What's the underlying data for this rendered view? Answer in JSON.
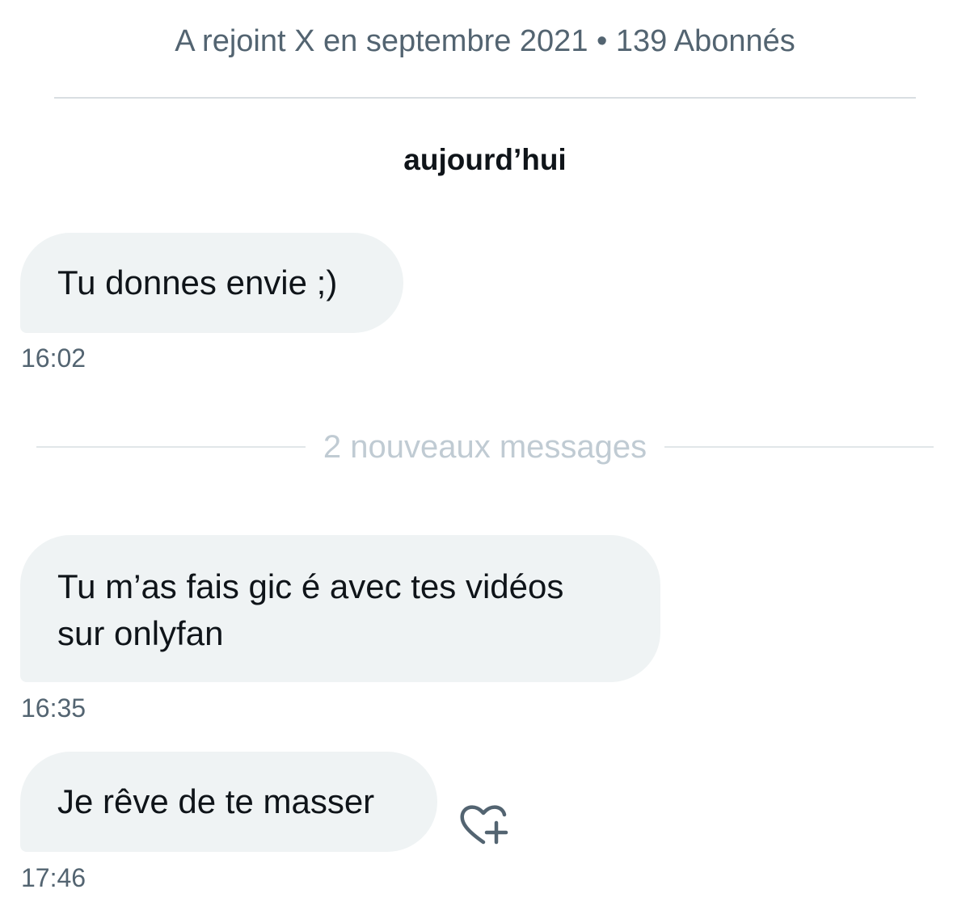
{
  "header": {
    "profile_meta": "A rejoint X en septembre 2021 • 139 Abonnés"
  },
  "conversation": {
    "day_label": "aujourd’hui",
    "new_messages_label": "2 nouveaux messages",
    "messages": [
      {
        "text": "Tu donnes envie ;)",
        "time": "16:02"
      },
      {
        "text": "Tu m’as fais gic é avec tes vidéos\nsur onlyfan",
        "time": "16:35"
      },
      {
        "text": "Je rêve de te masser",
        "time": "17:46"
      }
    ]
  },
  "icons": {
    "react": "heart-plus-icon"
  },
  "colors": {
    "bubble_bg": "#eff3f4",
    "secondary_text": "#536471",
    "divider_label": "#c0cbd3"
  }
}
